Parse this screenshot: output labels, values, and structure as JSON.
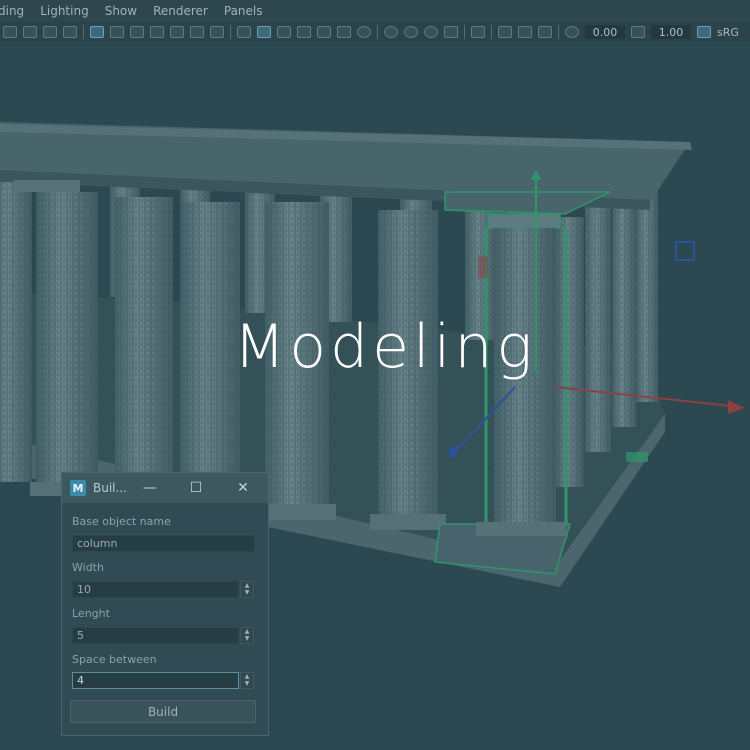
{
  "overlay_title": "Modeling",
  "menu": [
    "ding",
    "Lighting",
    "Show",
    "Renderer",
    "Panels"
  ],
  "toolbar": {
    "field_a": "0.00",
    "field_b": "1.00",
    "colorspace": "sRG"
  },
  "dialog": {
    "title": "Buil...",
    "logo_letter": "M",
    "minimize_glyph": "—",
    "maximize_glyph": "☐",
    "close_glyph": "✕",
    "base_name_label": "Base object name",
    "base_name_value": "column",
    "width_label": "Width",
    "width_value": "10",
    "length_label": "Lenght",
    "length_value": "5",
    "space_label": "Space between",
    "space_value": "4",
    "build_label": "Build",
    "spin_up": "▲",
    "spin_down": "▼"
  },
  "colors": {
    "overlay_tint": "#2e4a52",
    "selection_green": "#2fbf77",
    "axis_red": "#c03a3a",
    "axis_blue": "#2a56c8"
  },
  "icons": [
    "camera-icon",
    "select-icon",
    "move-icon",
    "grid-icon",
    "shaded-icon",
    "light-icon",
    "sphere-icon",
    "snap-icon",
    "exposure-icon",
    "gamma-icon"
  ]
}
